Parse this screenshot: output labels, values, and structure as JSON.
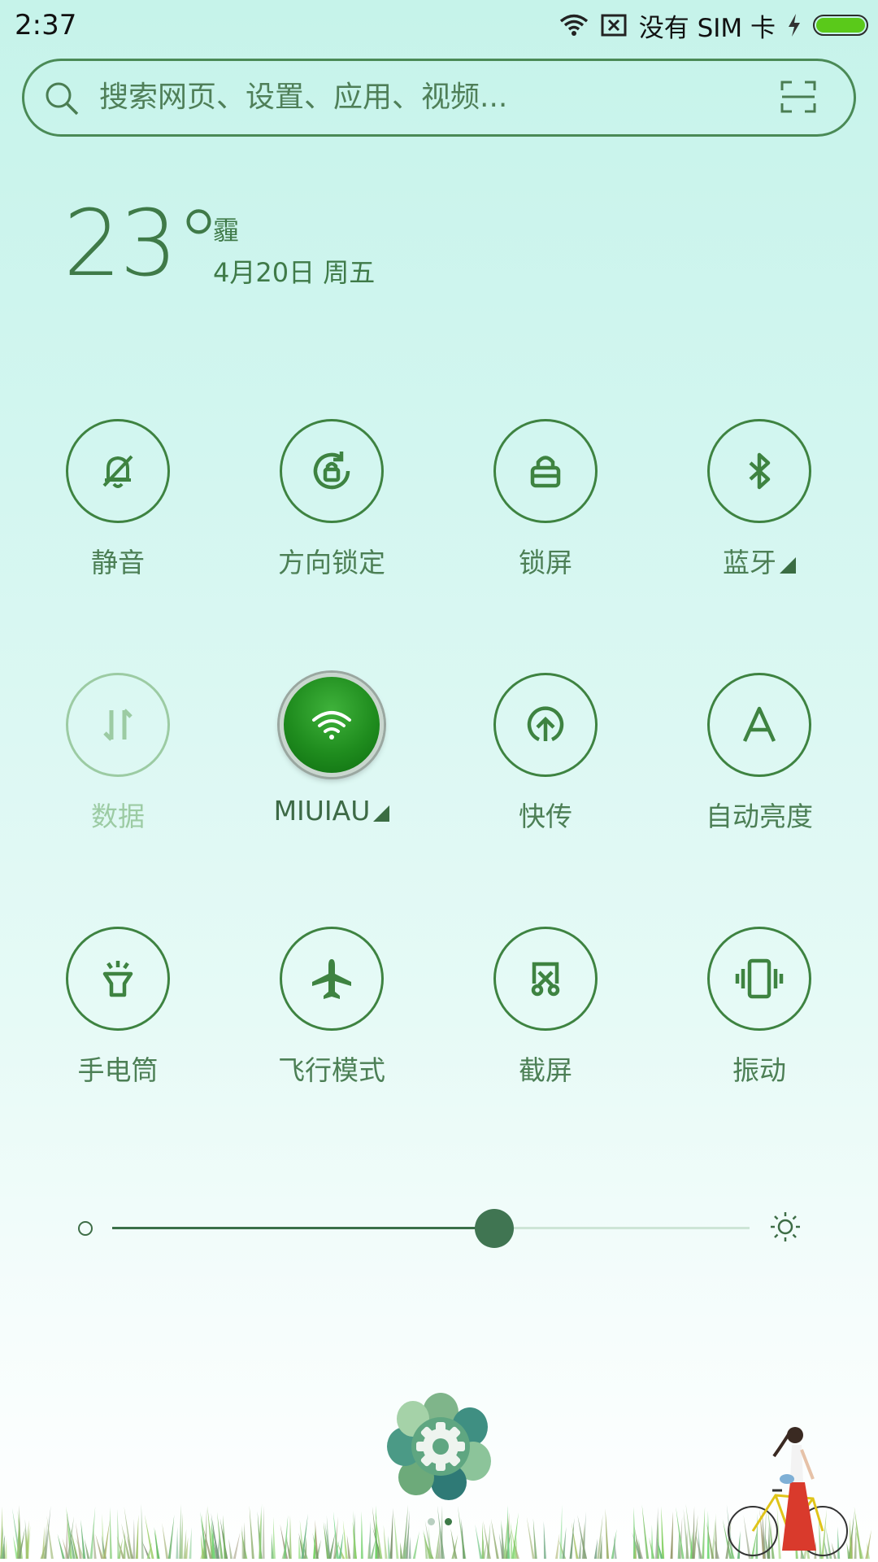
{
  "status_bar": {
    "time": "2:37",
    "sim_text": "没有 SIM 卡",
    "battery_level": 1.0,
    "icons": [
      "wifi-icon",
      "no-sim-icon",
      "charging-icon",
      "battery-icon"
    ]
  },
  "search": {
    "placeholder": "搜索网页、设置、应用、视频...",
    "icons": [
      "search-icon",
      "scan-icon"
    ]
  },
  "weather": {
    "temperature": "23°",
    "condition": "霾",
    "date": "4月20日 周五"
  },
  "toggles": [
    {
      "label": "静音",
      "icon": "bell-off-icon",
      "active": false
    },
    {
      "label": "方向锁定",
      "icon": "rotation-lock-icon",
      "active": false
    },
    {
      "label": "锁屏",
      "icon": "lock-icon",
      "active": false
    },
    {
      "label": "蓝牙",
      "icon": "bluetooth-icon",
      "active": false,
      "expandable": true
    },
    {
      "label": "数据",
      "icon": "mobile-data-icon",
      "active": false,
      "disabled": true
    },
    {
      "label": "MIUIAU",
      "icon": "wifi-icon",
      "active": true,
      "expandable": true
    },
    {
      "label": "快传",
      "icon": "upload-icon",
      "active": false
    },
    {
      "label": "自动亮度",
      "icon": "auto-brightness-icon",
      "active": false
    },
    {
      "label": "手电筒",
      "icon": "flashlight-icon",
      "active": false
    },
    {
      "label": "飞行模式",
      "icon": "airplane-icon",
      "active": false
    },
    {
      "label": "截屏",
      "icon": "screenshot-icon",
      "active": false
    },
    {
      "label": "振动",
      "icon": "vibrate-icon",
      "active": false
    }
  ],
  "brightness": {
    "level": 0.6
  },
  "pager": {
    "page_count": 2,
    "current_page": 2
  },
  "colors": {
    "accent": "#3e8341",
    "wifi_active": "#1f8c1e",
    "battery": "#5ac91a"
  }
}
